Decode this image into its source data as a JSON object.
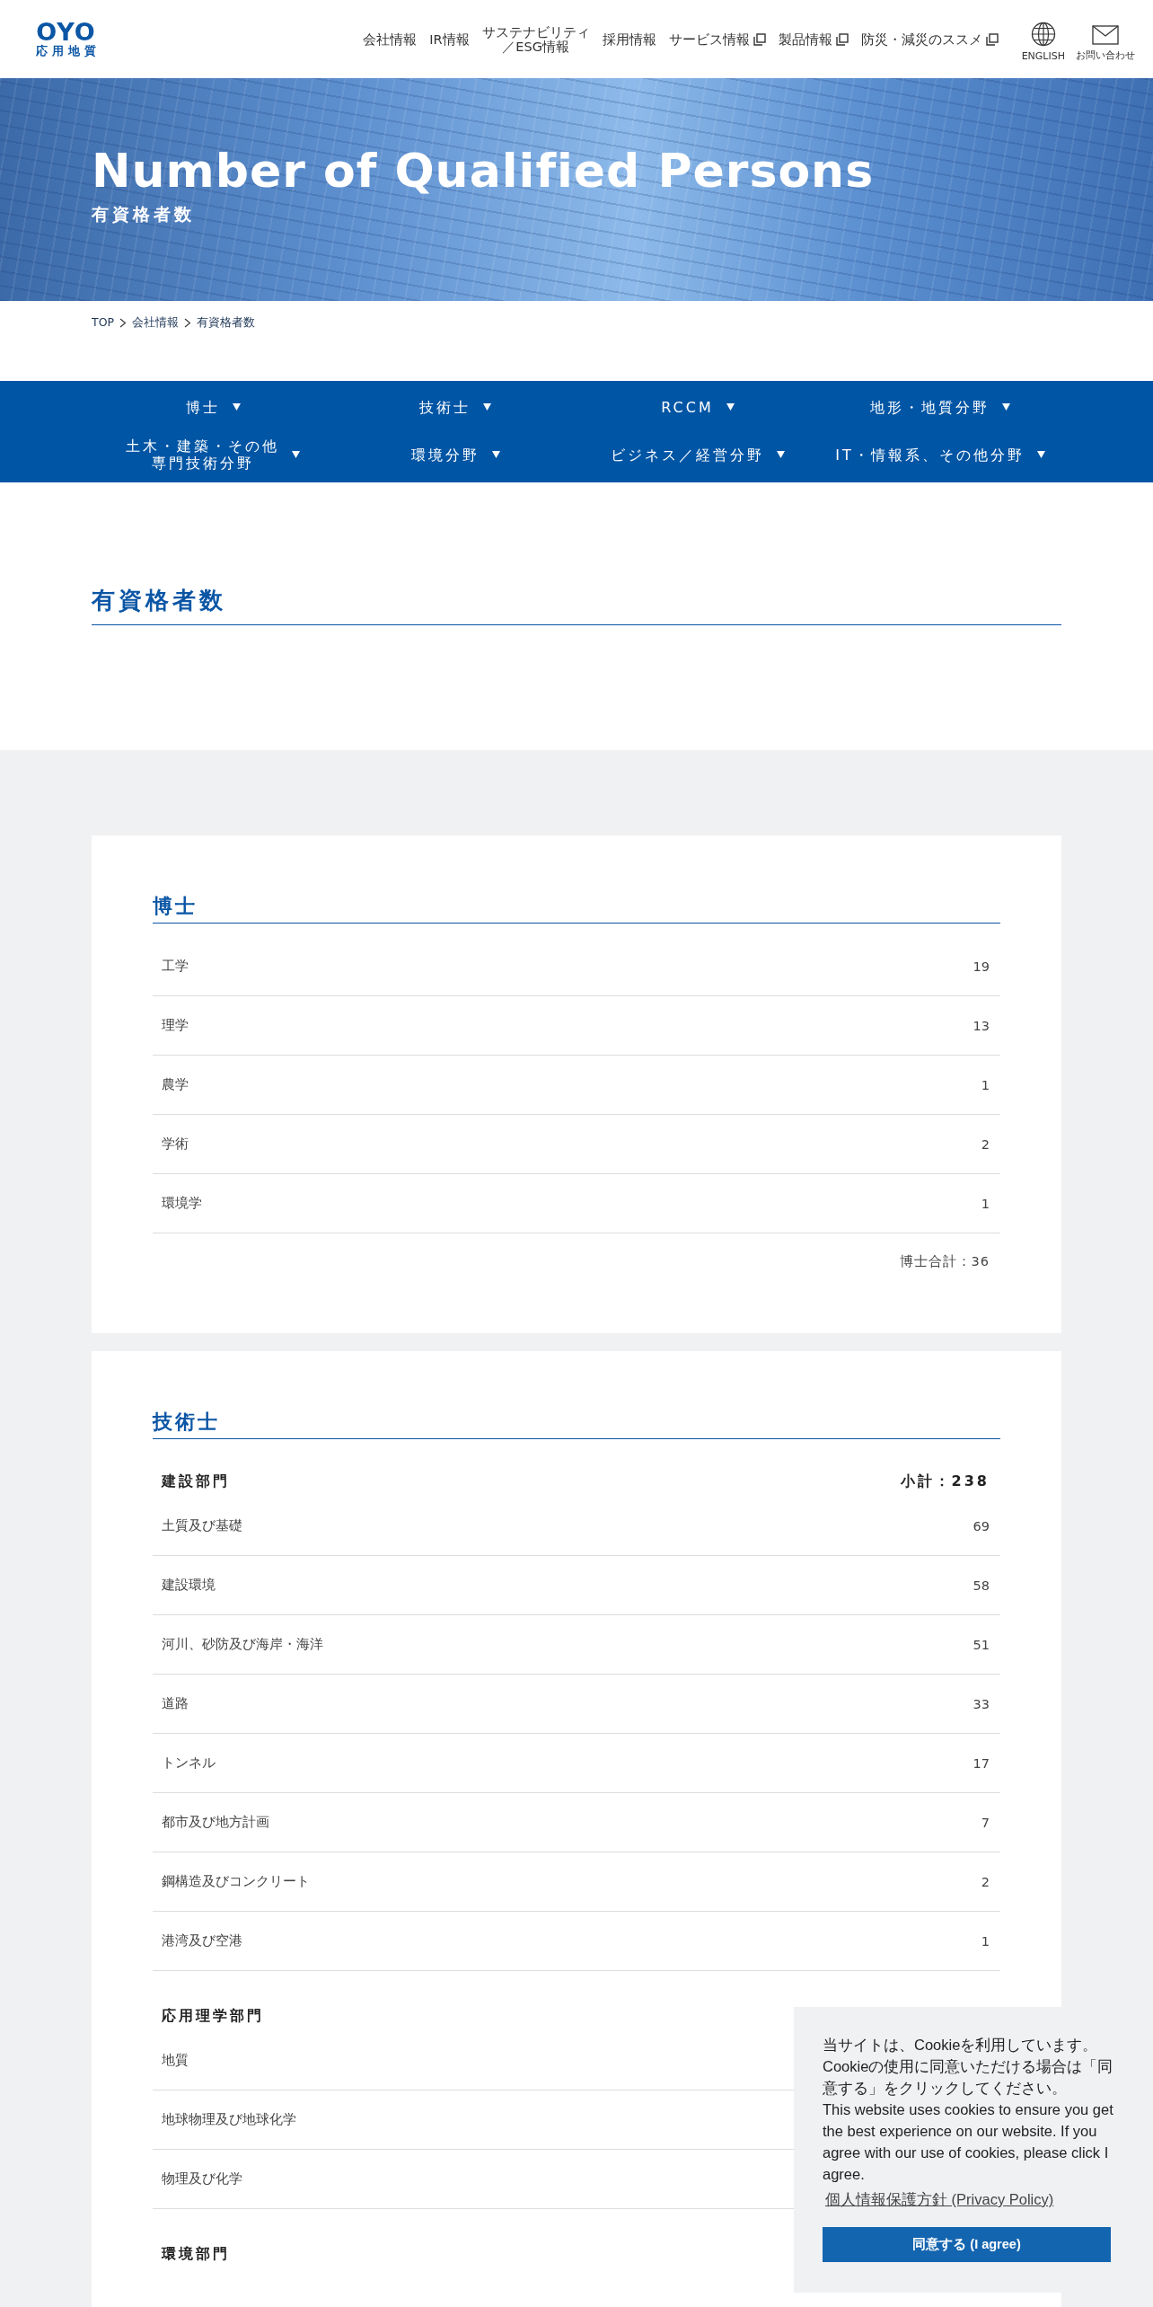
{
  "header": {
    "logo": {
      "wordmark": "OYO",
      "subtitle": "応用地質"
    },
    "nav": [
      {
        "label": "会社情報",
        "external": false
      },
      {
        "label": "IR情報",
        "external": false
      },
      {
        "lines": [
          "サステナビリティ",
          "／ESG情報"
        ],
        "external": false
      },
      {
        "label": "採用情報",
        "external": false
      },
      {
        "label": "サービス情報",
        "external": true
      },
      {
        "label": "製品情報",
        "external": true
      },
      {
        "label": "防災・減災のススメ",
        "external": true
      }
    ],
    "utilities": [
      {
        "kind": "globe",
        "label": "ENGLISH"
      },
      {
        "kind": "mail",
        "label": "お問い合わせ"
      }
    ]
  },
  "hero": {
    "title": "Number of Qualified Persons",
    "subtitle": "有資格者数"
  },
  "breadcrumb": [
    "TOP",
    "会社情報",
    "有資格者数"
  ],
  "category_nav": [
    {
      "label": "博士"
    },
    {
      "label": "技術士"
    },
    {
      "label": "RCCM"
    },
    {
      "label": "地形・地質分野"
    },
    {
      "lines": [
        "土木・建築・その他",
        "専門技術分野"
      ]
    },
    {
      "label": "環境分野"
    },
    {
      "label": "ビジネス／経営分野"
    },
    {
      "label": "IT・情報系、その他分野"
    }
  ],
  "page_heading": "有資格者数",
  "cards": [
    {
      "title": "博士",
      "groups": [
        {
          "rows": [
            {
              "label": "工学",
              "count": "19"
            },
            {
              "label": "理学",
              "count": "13"
            },
            {
              "label": "農学",
              "count": "1"
            },
            {
              "label": "学術",
              "count": "2"
            },
            {
              "label": "環境学",
              "count": "1"
            }
          ]
        }
      ],
      "total": "博士合計：36"
    },
    {
      "title": "技術士",
      "groups": [
        {
          "name": "建設部門",
          "subtotal": "小計：238",
          "rows": [
            {
              "label": "土質及び基礎",
              "count": "69"
            },
            {
              "label": "建設環境",
              "count": "58"
            },
            {
              "label": "河川、砂防及び海岸・海洋",
              "count": "51"
            },
            {
              "label": "道路",
              "count": "33"
            },
            {
              "label": "トンネル",
              "count": "17"
            },
            {
              "label": "都市及び地方計画",
              "count": "7"
            },
            {
              "label": "鋼構造及びコンクリート",
              "count": "2"
            },
            {
              "label": "港湾及び空港",
              "count": "1"
            }
          ]
        },
        {
          "name": "応用理学部門",
          "rows": [
            {
              "label": "地質"
            },
            {
              "label": "地球物理及び地球化学"
            },
            {
              "label": "物理及び化学"
            }
          ]
        },
        {
          "name": "環境部門"
        }
      ]
    }
  ],
  "cookie_banner": {
    "message_ja": "当サイトは、Cookieを利用しています。Cookieの使用に同意いただける場合は「同意する」をクリックしてください。",
    "message_en": "This website uses cookies to ensure you get the best experience on our website. If you agree with our use of cookies, please click I agree.",
    "policy_link": "個人情報保護方針 (Privacy Policy)",
    "accept_button": "同意する (I agree)"
  }
}
